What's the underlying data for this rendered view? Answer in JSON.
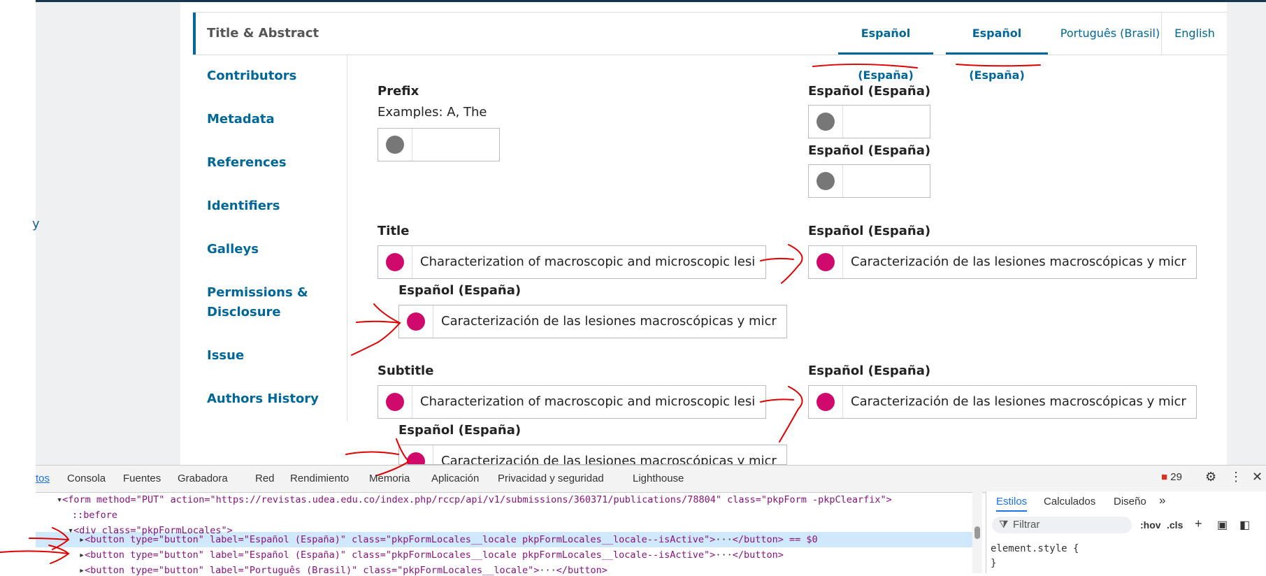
{
  "left_fragment": "y",
  "header": {
    "title": "Title & Abstract",
    "tabs": [
      {
        "label": "Español (España)",
        "active": true
      },
      {
        "label": "Español (España)",
        "active": true
      },
      {
        "label": "Português (Brasil)",
        "active": false
      },
      {
        "label": "English",
        "active": false
      }
    ]
  },
  "sidebar": {
    "items": [
      {
        "label": "Contributors"
      },
      {
        "label": "Metadata"
      },
      {
        "label": "References"
      },
      {
        "label": "Identifiers"
      },
      {
        "label": "Galleys"
      },
      {
        "label": "Permissions & Disclosure"
      },
      {
        "label": "Issue"
      },
      {
        "label": "Authors History"
      }
    ]
  },
  "form": {
    "prefix": {
      "label": "Prefix",
      "description": "Examples: A, The",
      "value": "",
      "locale_labels": [
        "Español (España)",
        "Español (España)"
      ]
    },
    "title": {
      "label": "Title",
      "value_en": "Characterization of macroscopic and microscopic lesions o",
      "locale_label_right": "Español (España)",
      "value_right": "Caracterización de las lesiones macroscópicas y microscóp",
      "locale_label_below": "Español (España)",
      "value_below": "Caracterización de las lesiones macroscópicas y microscóp"
    },
    "subtitle": {
      "label": "Subtitle",
      "value_en": "Characterization of macroscopic and microscopic lesions o",
      "locale_label_right": "Español (España)",
      "value_right": "Caracterización de las lesiones macroscópicas y microscóp",
      "locale_label_below": "Español (España)",
      "value_below": "Caracterización de las lesiones macroscópicas y microscóp"
    }
  },
  "devtools": {
    "tabs": [
      "tos",
      "Consola",
      "Fuentes",
      "Grabadora",
      "Red",
      "Rendimiento",
      "Memoria",
      "Aplicación",
      "Privacidad y seguridad",
      "Lighthouse"
    ],
    "error_count": "29",
    "styles_tabs": [
      "Estilos",
      "Calculados",
      "Diseño"
    ],
    "filter_placeholder": "Filtrar",
    "hov": ":hov",
    "cls": ".cls",
    "element_style": "element.style {",
    "element_style_close": "}",
    "lines": {
      "form_open": "<form method=\"PUT\" action=\"https://revistas.udea.edu.co/index.php/rccp/api/v1/submissions/360371/publications/78804\" class=\"pkpForm -pkpClearfix\">",
      "before": "::before",
      "div_open": "<div class=\"pkpFormLocales\">",
      "button1": "<button type=\"button\" label=\"Español (España)\" class=\"pkpFormLocales__locale pkpFormLocales__locale--isActive\">",
      "button1_tail": "</button> == $0",
      "button2": "<button type=\"button\" label=\"Español (España)\" class=\"pkpFormLocales__locale pkpFormLocales__locale--isActive\">",
      "button2_tail": "</button>",
      "button3": "<button type=\"button\" label=\"Português (Brasil)\" class=\"pkpFormLocales__locale\">",
      "button3_tail": "</button>"
    },
    "ellipsis": "···",
    "more": "»"
  },
  "colors": {
    "accent": "#006798",
    "locale_icon": "#d00a6c",
    "annotation": "#e00000"
  }
}
